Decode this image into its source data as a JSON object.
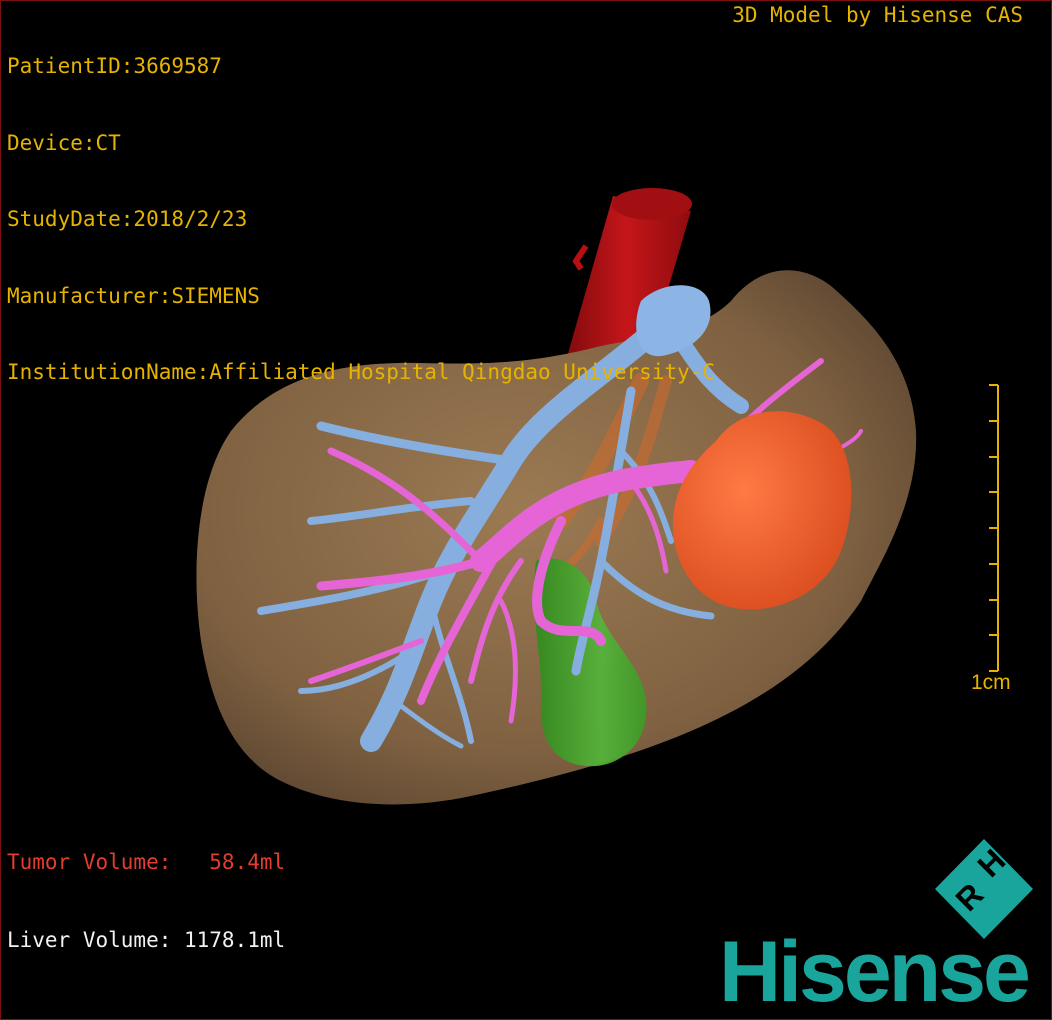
{
  "patient_info": {
    "patient_id": "PatientID:3669587",
    "device": "Device:CT",
    "study_date": "StudyDate:2018/2/23",
    "manufacturer": "Manufacturer:SIEMENS",
    "institution": "InstitutionName:Affiliated Hospital Qingdao University-C"
  },
  "credit": "3D Model by Hisense CAS",
  "volumes": {
    "tumor": "Tumor Volume:   58.4ml",
    "liver": "Liver Volume: 1178.1ml"
  },
  "scale_bar": {
    "label": "1cm"
  },
  "logo": {
    "mark": "RH",
    "text": "Hisense"
  },
  "colors": {
    "overlay_text": "#e6b400",
    "tumor_text": "#e23d2f",
    "liver": "#8a6a47",
    "aorta": "#b70f12",
    "portal_vein": "#7fa8d9",
    "hepatic_vein": "#e15fd1",
    "tumor": "#ef5d2a",
    "gallbladder": "#3f9d22",
    "logo": "#1aa59c"
  }
}
